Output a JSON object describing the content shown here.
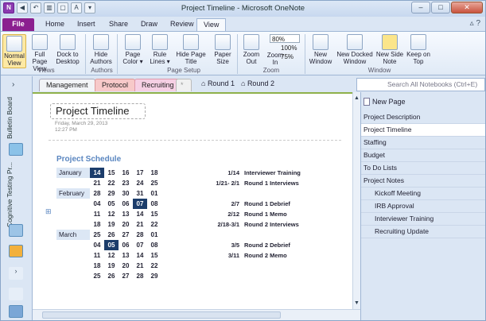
{
  "window": {
    "title": "Project Timeline - Microsoft OneNote"
  },
  "ribbon_tabs": [
    "File",
    "Home",
    "Insert",
    "Share",
    "Draw",
    "Review",
    "View"
  ],
  "ribbon": {
    "buttons": [
      {
        "label": "Normal View"
      },
      {
        "label": "Full Page View"
      },
      {
        "label": "Dock to Desktop"
      },
      {
        "label": "Hide Authors"
      },
      {
        "label": "Page Color ▾"
      },
      {
        "label": "Rule Lines ▾"
      },
      {
        "label": "Hide Page Title"
      },
      {
        "label": "Paper Size"
      },
      {
        "label": "Zoom Out"
      },
      {
        "label": "Zoom In"
      },
      {
        "label": "New Window"
      },
      {
        "label": "New Docked Window"
      },
      {
        "label": "New Side Note"
      },
      {
        "label": "Keep on Top"
      }
    ],
    "zoom": {
      "value": "80%",
      "opt100": "100%",
      "opt75": "75%"
    },
    "groups": [
      "Views",
      "Authors",
      "Page Setup",
      "Zoom",
      "Window"
    ]
  },
  "notebooks": {
    "bulletin": "Bulletin Board",
    "cognitive": "Cognitive Testing Pr..."
  },
  "sections": [
    {
      "label": "Management",
      "color": "#f2f4f7"
    },
    {
      "label": "Protocol",
      "color": "#f7c9c9"
    },
    {
      "label": "Recruiting",
      "color": "#f6d0e4"
    },
    {
      "label": "*",
      "color": "#f0f0f0"
    }
  ],
  "section_groups": [
    "Round 1",
    "Round 2"
  ],
  "search": {
    "placeholder": "Search All Notebooks (Ctrl+E)"
  },
  "page": {
    "title": "Project Timeline",
    "date": "Friday, March 29, 2013",
    "time": "12:27 PM",
    "schedule_title": "Project Schedule",
    "calendar": [
      {
        "month": "January",
        "days": [
          "14",
          "15",
          "16",
          "17",
          "18"
        ],
        "hl": 0
      },
      {
        "month": "",
        "days": [
          "21",
          "22",
          "23",
          "24",
          "25"
        ]
      },
      {
        "month": "February",
        "days": [
          "28",
          "29",
          "30",
          "31",
          "01"
        ]
      },
      {
        "month": "",
        "days": [
          "04",
          "05",
          "06",
          "07",
          "08"
        ],
        "hl": 3
      },
      {
        "month": "",
        "days": [
          "11",
          "12",
          "13",
          "14",
          "15"
        ]
      },
      {
        "month": "",
        "days": [
          "18",
          "19",
          "20",
          "21",
          "22"
        ]
      },
      {
        "month": "March",
        "days": [
          "25",
          "26",
          "27",
          "28",
          "01"
        ]
      },
      {
        "month": "",
        "days": [
          "04",
          "05",
          "06",
          "07",
          "08"
        ],
        "hl": 1
      },
      {
        "month": "",
        "days": [
          "11",
          "12",
          "13",
          "14",
          "15"
        ]
      },
      {
        "month": "",
        "days": [
          "18",
          "19",
          "20",
          "21",
          "22"
        ]
      },
      {
        "month": "",
        "days": [
          "25",
          "26",
          "27",
          "28",
          "29"
        ]
      }
    ],
    "events": [
      {
        "date": "1/14",
        "name": "Interviewer Training",
        "row": 0
      },
      {
        "date": "1/21- 2/1",
        "name": "Round 1 Interviews",
        "row": 1
      },
      {
        "date": "2/7",
        "name": "Round 1 Debrief",
        "row": 3
      },
      {
        "date": "2/12",
        "name": "Round 1 Memo",
        "row": 4
      },
      {
        "date": "2/18-3/1",
        "name": "Round 2 Interviews",
        "row": 5
      },
      {
        "date": "3/5",
        "name": "Round 2 Debrief",
        "row": 7
      },
      {
        "date": "3/11",
        "name": "Round 2 Memo",
        "row": 8
      }
    ]
  },
  "pages_panel": {
    "new_page": "New Page",
    "pages": [
      {
        "label": "Project Description",
        "sub": false
      },
      {
        "label": "Project Timeline",
        "sub": false,
        "selected": true
      },
      {
        "label": "Staffing",
        "sub": false
      },
      {
        "label": "Budget",
        "sub": false
      },
      {
        "label": "To Do Lists",
        "sub": false
      },
      {
        "label": "Project Notes",
        "sub": false
      },
      {
        "label": "Kickoff Meeting",
        "sub": true
      },
      {
        "label": "IRB Approval",
        "sub": true
      },
      {
        "label": "Interviewer Training",
        "sub": true
      },
      {
        "label": "Recruiting Update",
        "sub": true
      }
    ]
  }
}
